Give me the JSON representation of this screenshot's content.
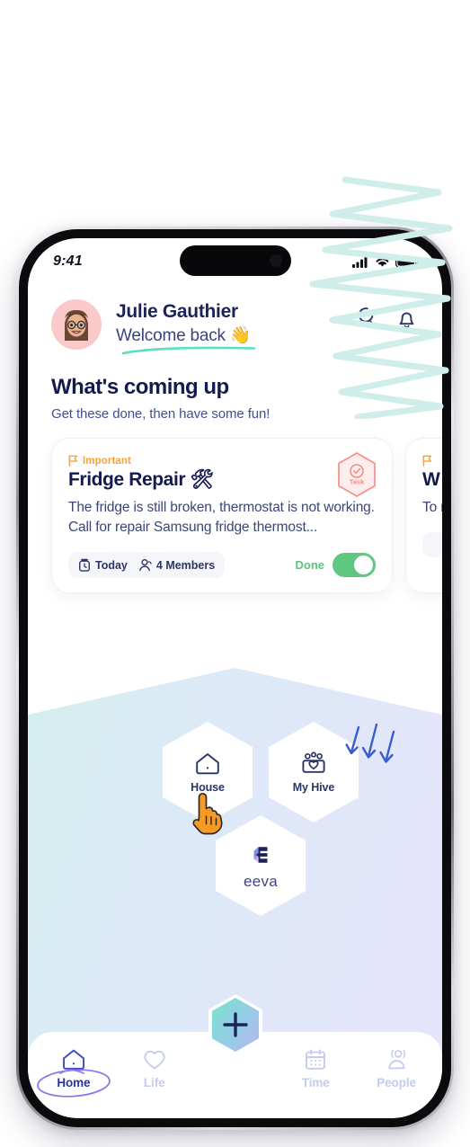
{
  "status_bar": {
    "time": "9:41",
    "icons": [
      "cellular-signal-icon",
      "wifi-icon",
      "battery-icon"
    ]
  },
  "header": {
    "user_name": "Julie Gauthier",
    "welcome_text": "Welcome back 👋",
    "avatar_name": "avatar",
    "actions": [
      {
        "name": "search-icon",
        "label": "Search"
      },
      {
        "name": "notification-bell-icon",
        "label": "Notifications"
      }
    ]
  },
  "section": {
    "title": "What's coming up",
    "subtitle": "Get these done, then have some fun!"
  },
  "cards": [
    {
      "flag": "Important",
      "title": "Fridge Repair 🛠",
      "description": "The fridge is still broken, thermostat is not working. Call for repair Samsung fridge thermost...",
      "badge_label": "Task",
      "meta": [
        {
          "icon": "timer-icon",
          "text": "Today"
        },
        {
          "icon": "members-icon",
          "text": "4 Members"
        }
      ],
      "toggle_label": "Done",
      "toggle_on": true
    },
    {
      "flag": "I",
      "title": "W",
      "description": "To m gi",
      "badge_label": "",
      "meta": [],
      "toggle_label": "",
      "toggle_on": false
    }
  ],
  "hex_tiles": [
    {
      "id": "house",
      "label": "House",
      "icon": "house-icon"
    },
    {
      "id": "hive",
      "label": "My Hive",
      "icon": "family-group-icon"
    },
    {
      "id": "eeva",
      "label": "eeva",
      "icon": "eeva-logo-icon"
    }
  ],
  "fab": {
    "label": "+",
    "name": "add-button"
  },
  "bottom_nav": [
    {
      "label": "Home",
      "icon": "home-icon",
      "active": true
    },
    {
      "label": "Life",
      "icon": "heart-icon",
      "active": false
    },
    {
      "label": "",
      "icon": "spacer",
      "active": false
    },
    {
      "label": "Time",
      "icon": "calendar-icon",
      "active": false
    },
    {
      "label": "People",
      "icon": "people-icon",
      "active": false
    }
  ],
  "annotations": {
    "scribble": "teal-zigzag-scribble",
    "arrows": "three-blue-down-arrows",
    "home_circle": "purple-ellipse-highlight",
    "welcome_underline": "mint-underline-stroke",
    "cursor": "orange-pointing-hand-cursor"
  },
  "colors": {
    "brand_navy": "#151c4d",
    "accent_orange": "#f7a23b",
    "accent_coral": "#f58a83",
    "toggle_green": "#5ec880",
    "nav_active": "#28349a",
    "nav_inactive": "#c3cbee",
    "scribble_teal": "#cfeeea",
    "panel_mint": "#d7efee",
    "panel_lavender": "#e3e6fa"
  }
}
